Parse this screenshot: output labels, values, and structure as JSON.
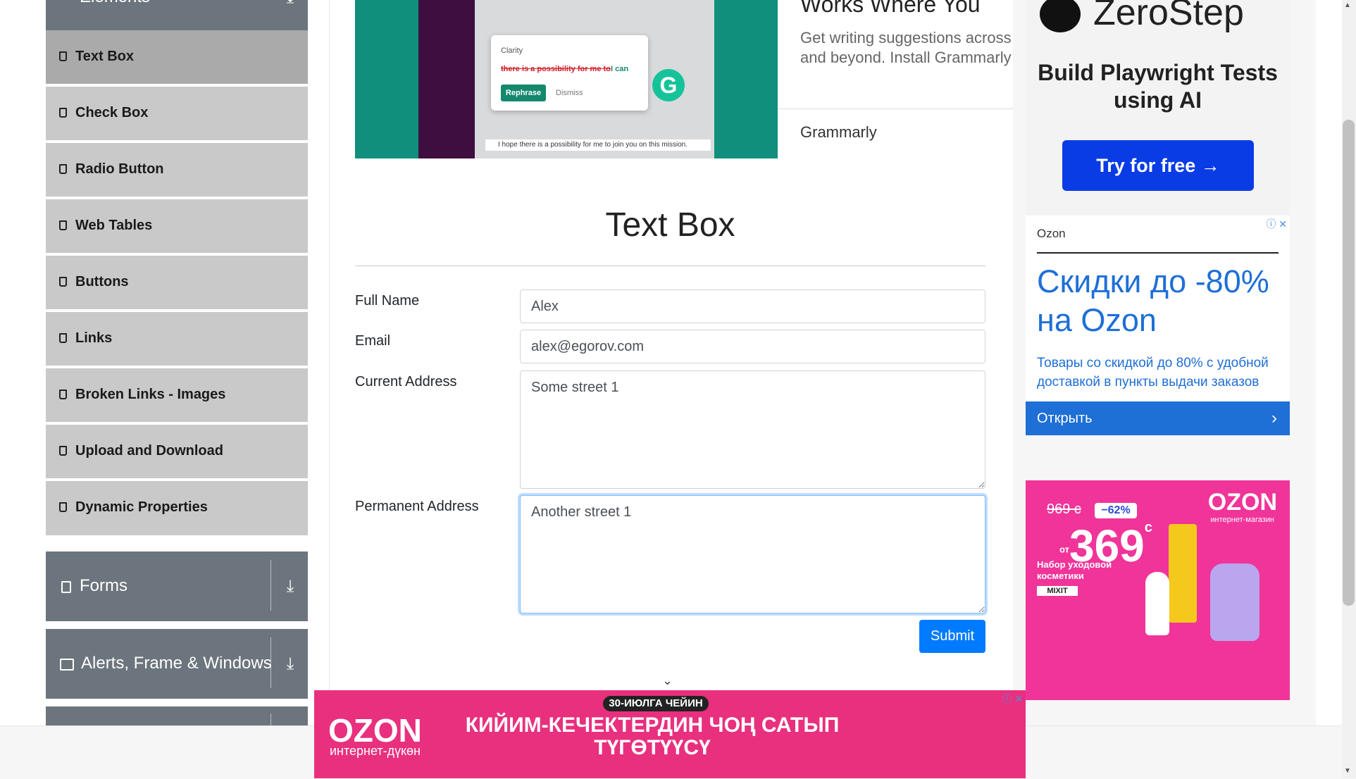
{
  "sidebar": {
    "top_group": {
      "label": "Elements"
    },
    "items": [
      {
        "label": "Text Box",
        "active": true
      },
      {
        "label": "Check Box"
      },
      {
        "label": "Radio Button"
      },
      {
        "label": "Web Tables"
      },
      {
        "label": "Buttons"
      },
      {
        "label": "Links"
      },
      {
        "label": "Broken Links - Images"
      },
      {
        "label": "Upload and Download"
      },
      {
        "label": "Dynamic Properties"
      }
    ],
    "groups": [
      {
        "label": "Forms"
      },
      {
        "label": "Alerts, Frame & Windows"
      }
    ]
  },
  "grammarly_ad": {
    "title": "Works Where You",
    "text": "Get writing suggestions across and beyond. Install Grammarly",
    "brand": "Grammarly",
    "popup_clarity": "Clarity",
    "popup_strike": "there is a possibility for me to",
    "popup_replace": "I can",
    "popup_rephrase": "Rephrase",
    "popup_dismiss": "Dismiss",
    "message_bar": "I hope there is a possibility for me to join you on this mission."
  },
  "page": {
    "title": "Text Box"
  },
  "form": {
    "full_name_label": "Full Name",
    "full_name_value": "Alex",
    "email_label": "Email",
    "email_value": "alex@egorov.com",
    "current_address_label": "Current Address",
    "current_address_value": "Some street 1",
    "permanent_address_label": "Permanent Address",
    "permanent_address_value": "Another street 1",
    "submit_label": "Submit"
  },
  "zerostep_ad": {
    "name": "ZeroStep",
    "headline": "Build Playwright Tests using AI",
    "button": "Try for free →"
  },
  "ozon_ad": {
    "brand": "Ozon",
    "headline": "Скидки до -80% на Ozon",
    "subtext": "Товары со скидкой до 80% с удобной доставкой в пункты выдачи заказов",
    "button": "Открыть"
  },
  "ozon_ad2": {
    "logo": "OZON",
    "logo_sub": "интернет-магазин",
    "old_price": "969 с",
    "discount": "−62%",
    "price": "369",
    "currency": "с",
    "price_prefix": "от",
    "desc": "Набор уходовой косметики",
    "brand": "MIXIT"
  },
  "bottom_ad": {
    "logo": "OZON",
    "logo_sub": "интернет-дүкөн",
    "pill": "30-ИЮЛГА ЧЕЙИН",
    "headline": "КИЙИМ-КЕЧЕКТЕРДИН ЧОҢ САТЫП ТҮГӨТҮҮСҮ"
  }
}
